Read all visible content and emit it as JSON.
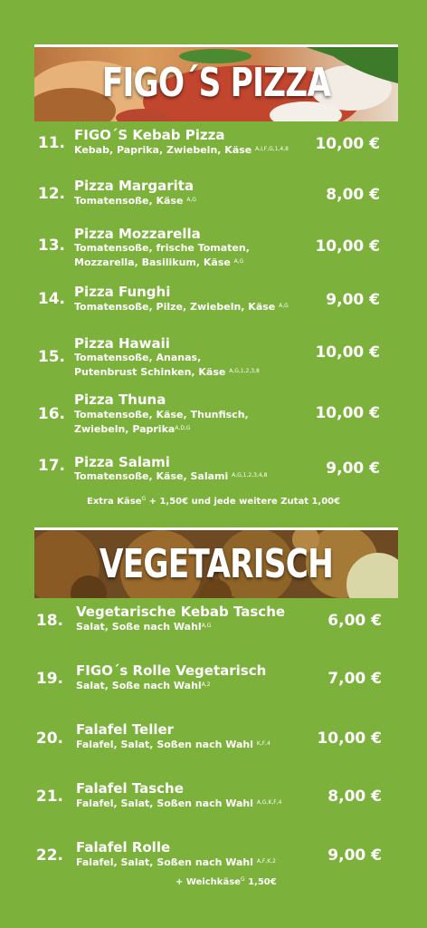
{
  "pizza_section": {
    "title": "FIGO´S PIZZA",
    "items": [
      {
        "number": "11.",
        "name": "FIGO´S Kebab Pizza",
        "desc": [
          "Kebab, Paprika, Zwiebeln, Käse"
        ],
        "allergens": "A,I,F,G,1,4,8",
        "price": "10,00 €"
      },
      {
        "number": "12.",
        "name": "Pizza Margarita",
        "desc": [
          "Tomatensoße, Käse"
        ],
        "allergens": "A,G",
        "price": "8,00 €"
      },
      {
        "number": "13.",
        "name": "Pizza Mozzarella",
        "desc": [
          "Tomatensoße, frische Tomaten,",
          "Mozzarella, Basilikum, Käse"
        ],
        "allergens": "A,G",
        "price": "10,00 €"
      },
      {
        "number": "14.",
        "name": "Pizza Funghi",
        "desc": [
          "Tomatensoße, Pilze, Zwiebeln, Käse"
        ],
        "allergens": "A,G",
        "price": "9,00 €"
      },
      {
        "number": "15.",
        "name": "Pizza Hawaii",
        "desc": [
          "Tomatensoße, Ananas,",
          "Putenbrust Schinken, Käse"
        ],
        "allergens": "A,G,1,2,3,8",
        "price": "10,00 €"
      },
      {
        "number": "16.",
        "name": "Pizza Thuna",
        "desc": [
          "Tomatensoße, Käse, Thunfisch,",
          "Zwiebeln, Paprika"
        ],
        "allergens": "A,D,G",
        "price": "10,00 €"
      },
      {
        "number": "17.",
        "name": "Pizza Salami",
        "desc": [
          "Tomatensoße, Käse, Salami"
        ],
        "allergens": "A,G,1,2,3,4,8",
        "price": "9,00 €"
      }
    ],
    "extra": {
      "prefix": "Extra Käse",
      "sup": "G",
      "text": "+ 1,50€ und jede weitere Zutat 1,00€"
    }
  },
  "veg_section": {
    "title": "VEGETARISCH",
    "items": [
      {
        "number": "18.",
        "name": "Vegetarische Kebab Tasche",
        "desc": [
          "Salat, Soße nach Wahl"
        ],
        "allergens": "A,G",
        "price": "6,00 €"
      },
      {
        "number": "19.",
        "name": "FIGO´s Rolle Vegetarisch",
        "desc": [
          "Salat, Soße nach Wahl"
        ],
        "allergens": "A,2",
        "price": "7,00 €"
      },
      {
        "number": "20.",
        "name": "Falafel Teller",
        "desc": [
          "Falafel, Salat, Soßen nach Wahl"
        ],
        "allergens": "K,F,4",
        "price": "10,00 €"
      },
      {
        "number": "21.",
        "name": "Falafel Tasche",
        "desc": [
          "Falafel, Salat, Soßen nach Wahl"
        ],
        "allergens": "A,G,K,F,4",
        "price": "8,00 €"
      },
      {
        "number": "22.",
        "name": "Falafel Rolle",
        "desc": [
          "Falafel, Salat, Soßen nach Wahl"
        ],
        "allergens": "A,F,K,2",
        "price": "9,00 €"
      }
    ],
    "extra": {
      "prefix": "+ Weichkäse",
      "sup": "G",
      "text": "1,50€"
    }
  },
  "colors": {
    "background": "#7cb13b",
    "text": "#ffffff"
  }
}
